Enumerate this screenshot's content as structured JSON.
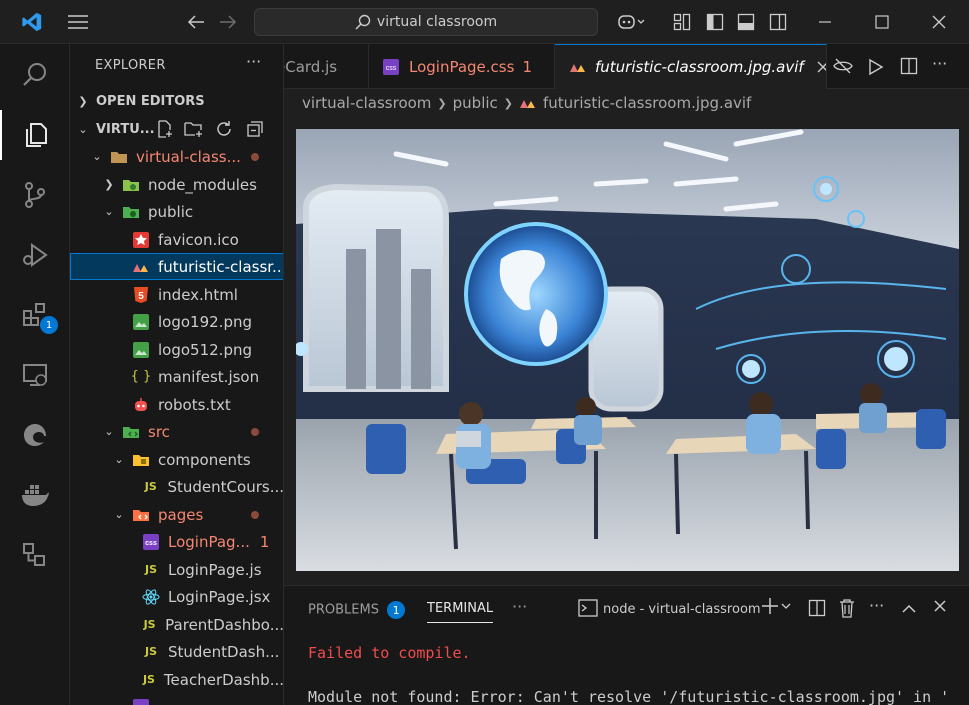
{
  "titlebar": {
    "search_text": "virtual classroom"
  },
  "activitybar": {
    "extensions_badge": "1"
  },
  "sidebar": {
    "header": "EXPLORER",
    "more": "···",
    "open_editors": "OPEN EDITORS",
    "workspace": "VIRTU...",
    "items": [
      {
        "label": "virtual-class...",
        "icon": "folder-open-icon"
      },
      {
        "label": "node_modules",
        "icon": "folder-node-icon"
      },
      {
        "label": "public",
        "icon": "folder-public-icon"
      },
      {
        "label": "favicon.ico",
        "icon": "star-icon"
      },
      {
        "label": "futuristic-classr...",
        "icon": "image-avif-icon"
      },
      {
        "label": "index.html",
        "icon": "html5-icon"
      },
      {
        "label": "logo192.png",
        "icon": "image-icon"
      },
      {
        "label": "logo512.png",
        "icon": "image-icon"
      },
      {
        "label": "manifest.json",
        "icon": "json-braces-icon"
      },
      {
        "label": "robots.txt",
        "icon": "robot-icon"
      },
      {
        "label": "src",
        "icon": "folder-src-icon"
      },
      {
        "label": "components",
        "icon": "folder-components-icon"
      },
      {
        "label": "StudentCours...",
        "icon": "js-icon"
      },
      {
        "label": "pages",
        "icon": "folder-pages-icon"
      },
      {
        "label": "LoginPag...",
        "icon": "css-icon",
        "count": "1"
      },
      {
        "label": "LoginPage.js",
        "icon": "js-icon"
      },
      {
        "label": "LoginPage.jsx",
        "icon": "react-icon"
      },
      {
        "label": "ParentDashbo...",
        "icon": "js-icon"
      },
      {
        "label": "StudentDash...",
        "icon": "js-icon"
      },
      {
        "label": "TeacherDashb...",
        "icon": "js-icon"
      }
    ]
  },
  "tabs": [
    {
      "label": "eCard.js",
      "icon": "js-icon"
    },
    {
      "label": "LoginPage.css",
      "count": "1",
      "icon": "css-icon"
    },
    {
      "label": "futuristic-classroom.jpg.avif",
      "icon": "image-avif-icon"
    }
  ],
  "breadcrumb": [
    "virtual-classroom",
    "public",
    "futuristic-classroom.jpg.avif"
  ],
  "panel": {
    "problems_label": "PROBLEMS",
    "problems_count": "1",
    "terminal_label": "TERMINAL",
    "more": "···",
    "terminal_name": "node - virtual-classroom",
    "lines": [
      "Failed to compile.",
      "Module not found: Error: Can't resolve '/futuristic-classroom.jpg' in '"
    ]
  },
  "icon_labels": {
    "js": "JS",
    "css": "css",
    "html": "5",
    "json": "{ }",
    "avif": "AVIF"
  },
  "colors": {
    "accent": "#0078d4",
    "error_text": "#f48771",
    "js_yellow": "#cbcb41",
    "css_purple": "#7a40c4"
  }
}
